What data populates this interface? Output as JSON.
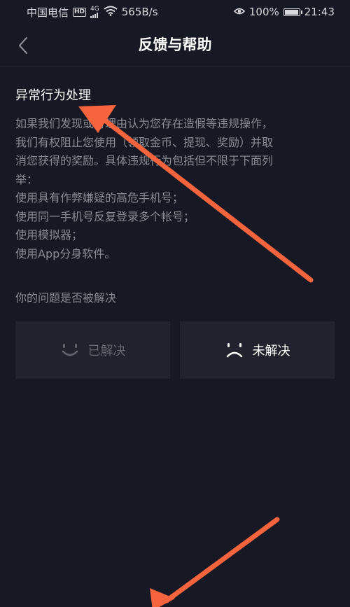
{
  "status_bar": {
    "carrier": "中国电信",
    "hd_badge": "HD",
    "network_type": "4G",
    "speed": "565B/s",
    "battery": "100%",
    "time": "21:43",
    "icons": [
      "hd-icon",
      "4g-signal-icon",
      "wifi-icon",
      "eye-icon",
      "battery-icon"
    ]
  },
  "nav": {
    "back_icon": "chevron-left-icon",
    "title": "反馈与帮助"
  },
  "article": {
    "title": "异常行为处理",
    "lines": [
      "如果我们发现或有理由认为您存在造假等违规操作，",
      "我们有权阻止您使用（领取金币、提现、奖励）并取",
      "消您获得的奖励。具体违规行为包括但不限于下面列",
      "举：",
      "使用具有作弊嫌疑的高危手机号；",
      "使用同一手机号反复登录多个帐号；",
      "使用模拟器；",
      "使用App分身软件。"
    ]
  },
  "feedback": {
    "question": "你的问题是否被解决",
    "resolved_label": "已解决",
    "unresolved_label": "未解决",
    "resolved_icon": "smile-icon",
    "unresolved_icon": "frown-icon"
  },
  "colors": {
    "background": "#161823",
    "button_bg": "#21222d",
    "body_text": "#8a8b93",
    "annotation_arrow": "#f5643c"
  }
}
